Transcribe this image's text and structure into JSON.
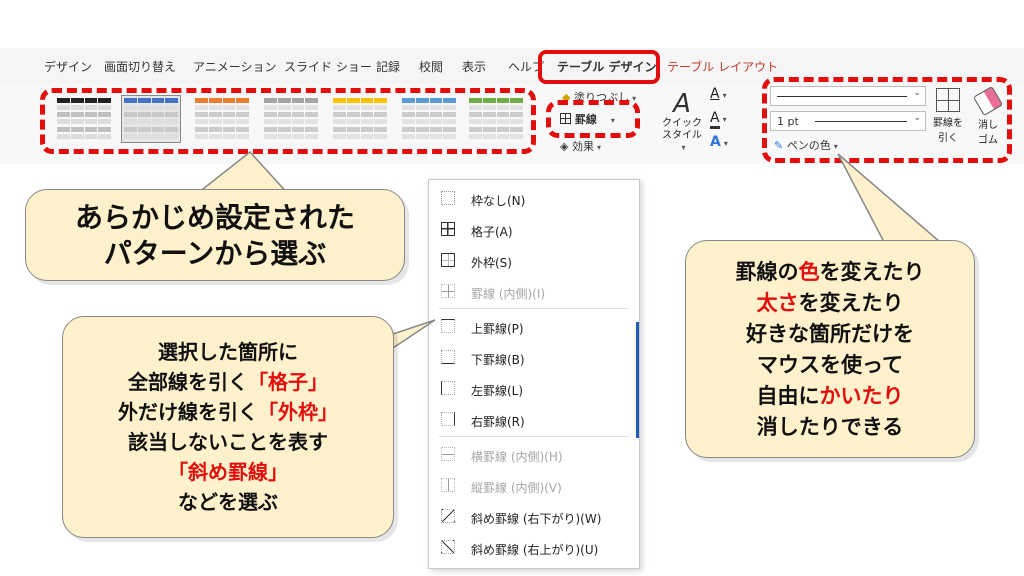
{
  "tabs": [
    {
      "label": "デザイン"
    },
    {
      "label": "画面切り替え"
    },
    {
      "label": "アニメーション"
    },
    {
      "label": "スライド ショー"
    },
    {
      "label": "記録"
    },
    {
      "label": "校閲"
    },
    {
      "label": "表示"
    },
    {
      "label": "ヘルプ"
    },
    {
      "label": "テーブル デザイン"
    },
    {
      "label": "テーブル レイアウト"
    }
  ],
  "styles_gallery": {
    "thumbnails": [
      {
        "color": "#222222"
      },
      {
        "color": "#4472c4"
      },
      {
        "color": "#ed7d31"
      },
      {
        "color": "#a5a5a5"
      },
      {
        "color": "#ffc000"
      },
      {
        "color": "#5b9bd5"
      },
      {
        "color": "#70ad47"
      }
    ]
  },
  "ribbon": {
    "shading_label": "塗りつぶし",
    "borders_label": "罫線",
    "effects_label": "効果",
    "quick_styles_label_1": "クイック",
    "quick_styles_label_2": "スタイル",
    "text_glyph": "A",
    "pen_weight_value": "1 pt",
    "pen_color_label": "ペンの色",
    "draw_table_label_1": "罫線を",
    "draw_table_label_2": "引く",
    "eraser_label_1": "消し",
    "eraser_label_2": "ゴム"
  },
  "menu": {
    "items": [
      {
        "label": "枠なし(N)",
        "disabled": false,
        "icon": "no-border-icon"
      },
      {
        "label": "格子(A)",
        "disabled": false,
        "icon": "all-borders-icon"
      },
      {
        "label": "外枠(S)",
        "disabled": false,
        "icon": "outside-borders-icon"
      },
      {
        "label": "罫線 (内側)(I)",
        "disabled": true,
        "icon": "inside-borders-icon"
      },
      {
        "label": "上罫線(P)",
        "disabled": false,
        "icon": "top-border-icon"
      },
      {
        "label": "下罫線(B)",
        "disabled": false,
        "icon": "bottom-border-icon"
      },
      {
        "label": "左罫線(L)",
        "disabled": false,
        "icon": "left-border-icon"
      },
      {
        "label": "右罫線(R)",
        "disabled": false,
        "icon": "right-border-icon"
      },
      {
        "label": "横罫線 (内側)(H)",
        "disabled": true,
        "icon": "inside-horizontal-border-icon"
      },
      {
        "label": "縦罫線 (内側)(V)",
        "disabled": true,
        "icon": "inside-vertical-border-icon"
      },
      {
        "label": "斜め罫線 (右下がり)(W)",
        "disabled": false,
        "icon": "diagonal-down-border-icon"
      },
      {
        "label": "斜め罫線 (右上がり)(U)",
        "disabled": false,
        "icon": "diagonal-up-border-icon"
      }
    ]
  },
  "callouts": {
    "presets": {
      "line1": "あらかじめ設定された",
      "line2": "パターンから選ぶ"
    },
    "borders": {
      "l1": "選択した箇所に",
      "l2a": "全部線を引く",
      "l2b": "「格子」",
      "l3a": "外だけ線を引く",
      "l3b": "「外枠」",
      "l4": "該当しないことを表す",
      "l5": "「斜め罫線」",
      "l6": "などを選ぶ"
    },
    "pen": {
      "l1a": "罫線の",
      "l1b": "色",
      "l1c": "を変えたり",
      "l2a": "太さ",
      "l2b": "を変えたり",
      "l3": "好きな箇所だけを",
      "l4": "マウスを使って",
      "l5a": "自由に",
      "l5b": "かいたり",
      "l6": "消したりできる"
    }
  },
  "colors": {
    "highlight_red": "#e20d0d",
    "callout_fill": "#fff1cc"
  }
}
